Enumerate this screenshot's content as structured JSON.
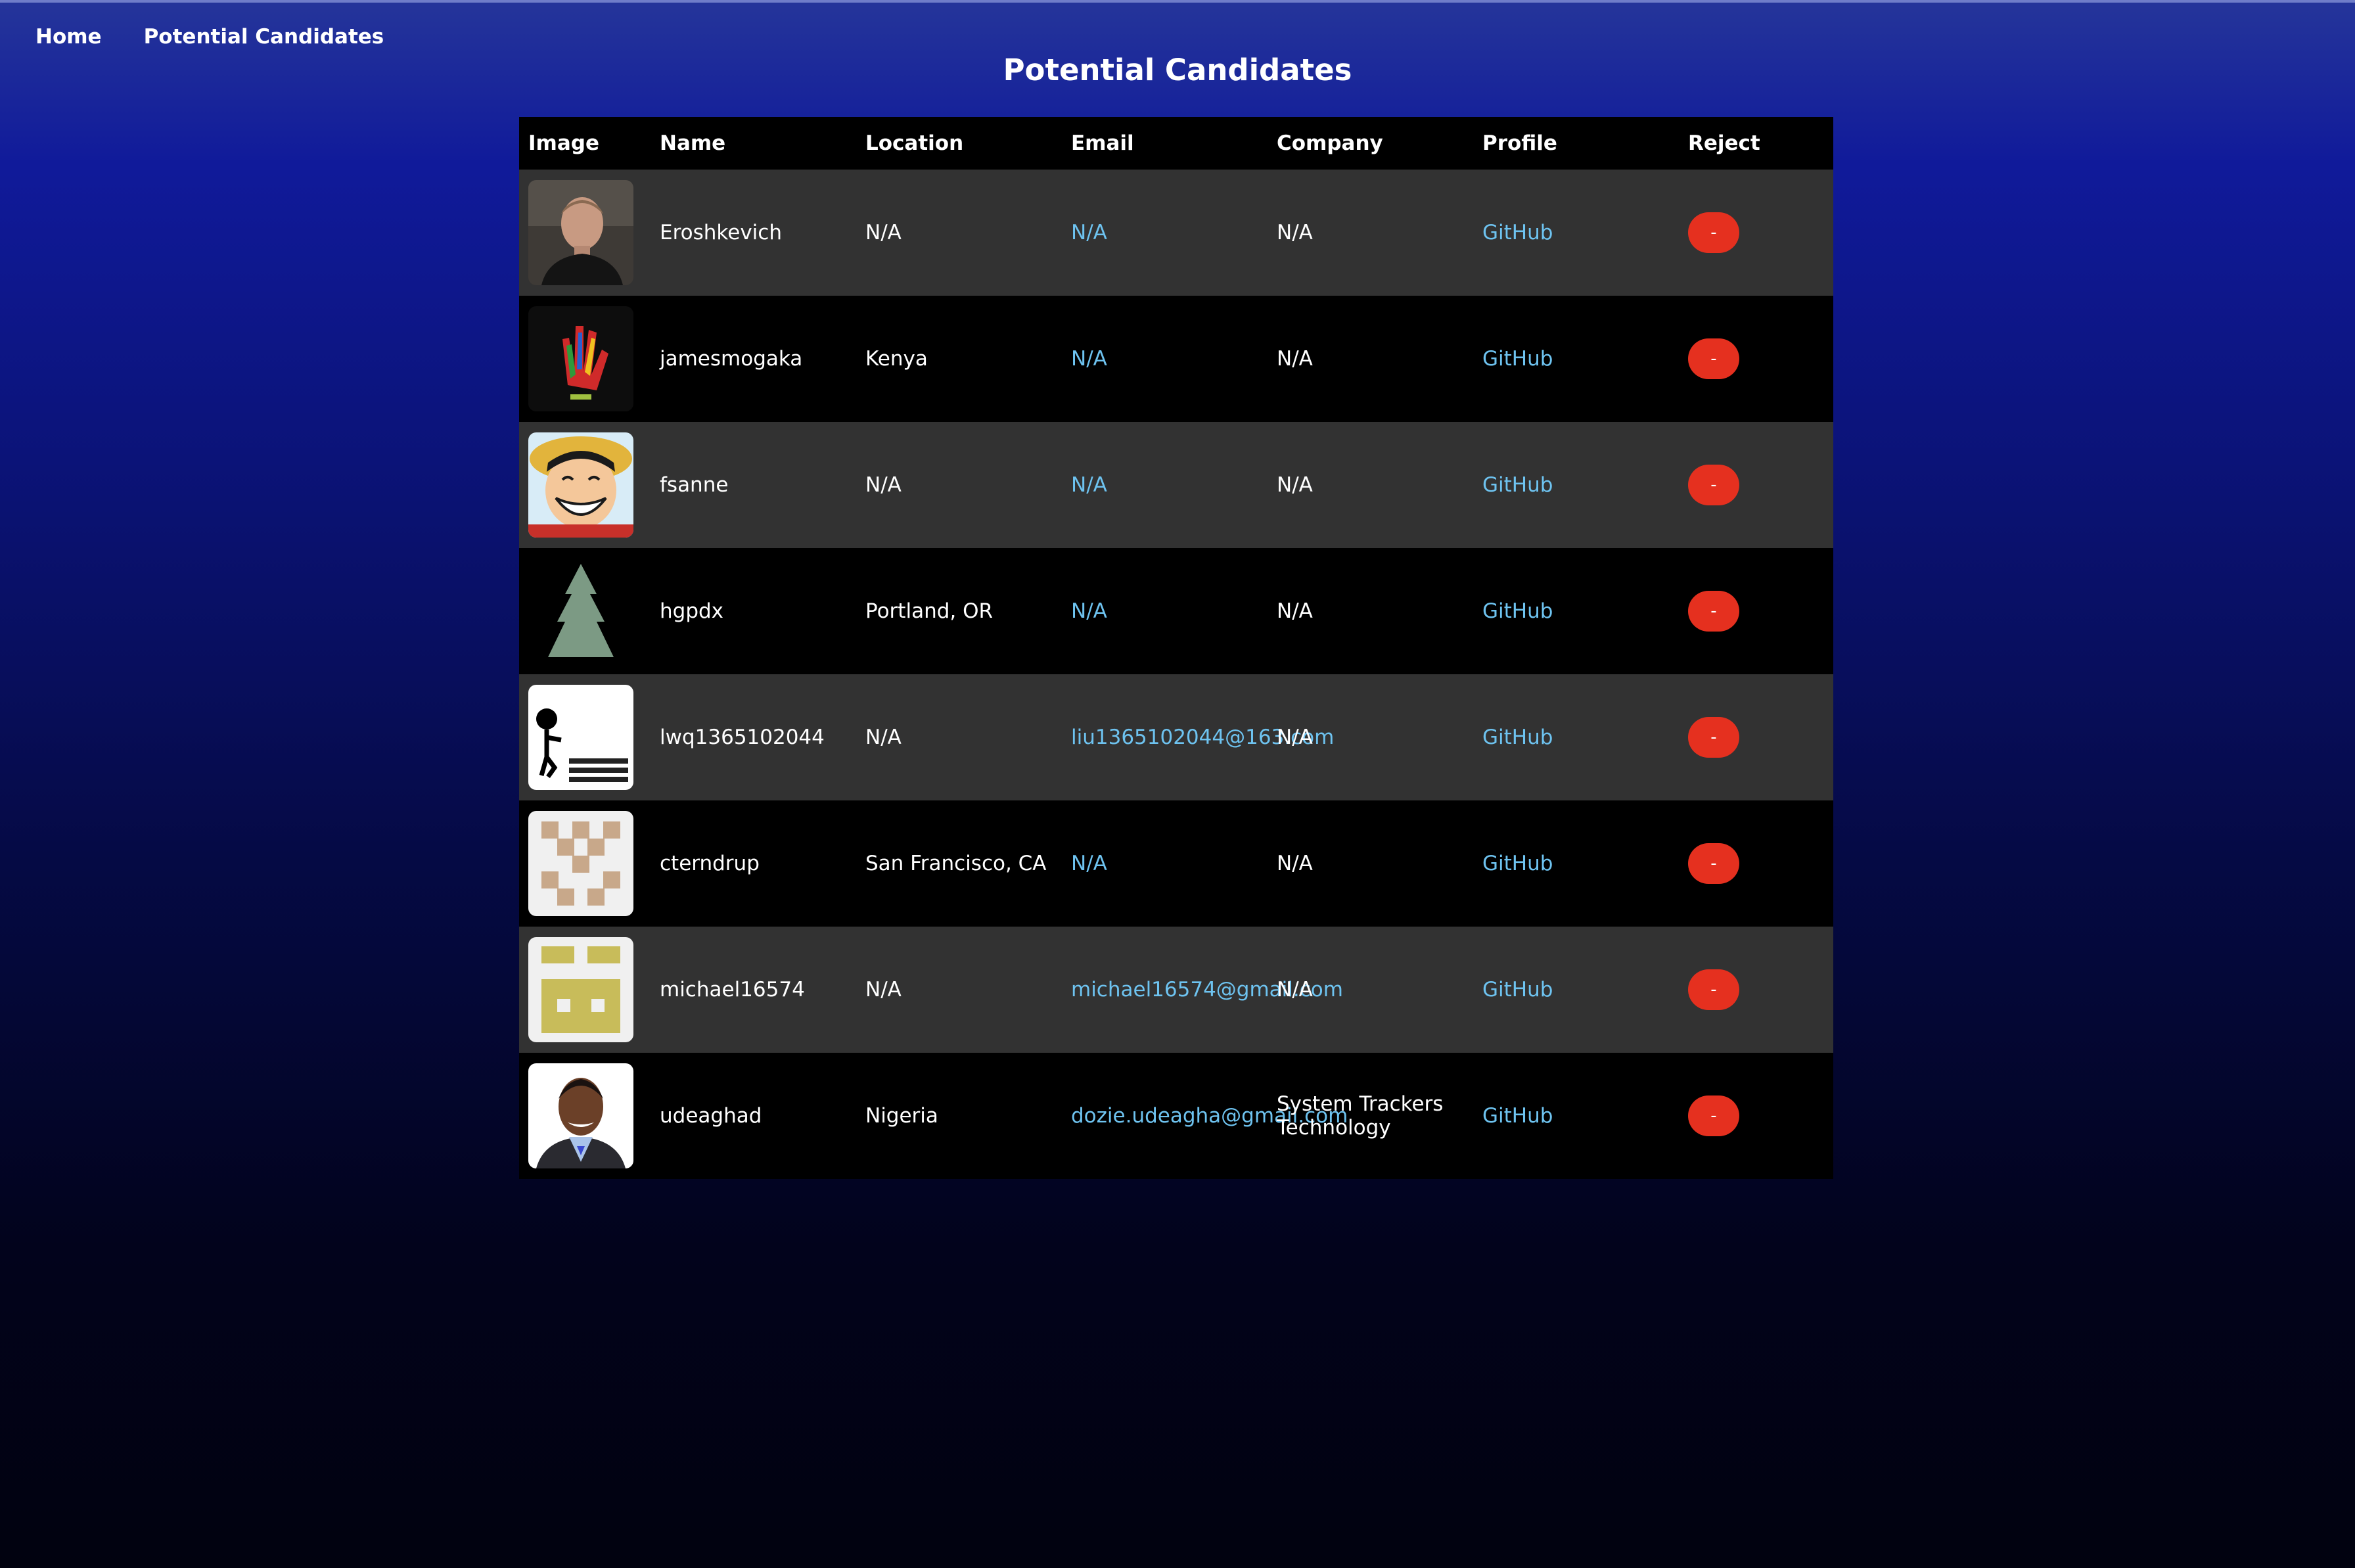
{
  "nav": {
    "home": "Home",
    "potential": "Potential Candidates"
  },
  "page_title": "Potential Candidates",
  "table": {
    "headers": {
      "image": "Image",
      "name": "Name",
      "location": "Location",
      "email": "Email",
      "company": "Company",
      "profile": "Profile",
      "reject": "Reject"
    },
    "rows": [
      {
        "name": "Eroshkevich",
        "location": "N/A",
        "email": "N/A",
        "company": "N/A",
        "profile": "GitHub",
        "reject": "-"
      },
      {
        "name": "jamesmogaka",
        "location": "Kenya",
        "email": "N/A",
        "company": "N/A",
        "profile": "GitHub",
        "reject": "-"
      },
      {
        "name": "fsanne",
        "location": "N/A",
        "email": "N/A",
        "company": "N/A",
        "profile": "GitHub",
        "reject": "-"
      },
      {
        "name": "hgpdx",
        "location": "Portland, OR",
        "email": "N/A",
        "company": "N/A",
        "profile": "GitHub",
        "reject": "-"
      },
      {
        "name": "lwq1365102044",
        "location": "N/A",
        "email": "liu1365102044@163.com",
        "company": "N/A",
        "profile": "GitHub",
        "reject": "-"
      },
      {
        "name": "cterndrup",
        "location": "San Francisco, CA",
        "email": "N/A",
        "company": "N/A",
        "profile": "GitHub",
        "reject": "-"
      },
      {
        "name": "michael16574",
        "location": "N/A",
        "email": "michael16574@gmail.com",
        "company": "N/A",
        "profile": "GitHub",
        "reject": "-"
      },
      {
        "name": "udeaghad",
        "location": "Nigeria",
        "email": "dozie.udeagha@gmail.com",
        "company": "System Trackers Technology",
        "profile": "GitHub",
        "reject": "-"
      }
    ]
  },
  "colors": {
    "link": "#6ec3f0",
    "reject_button": "#e5301f",
    "row_odd": "#323232",
    "row_even": "#000000"
  }
}
